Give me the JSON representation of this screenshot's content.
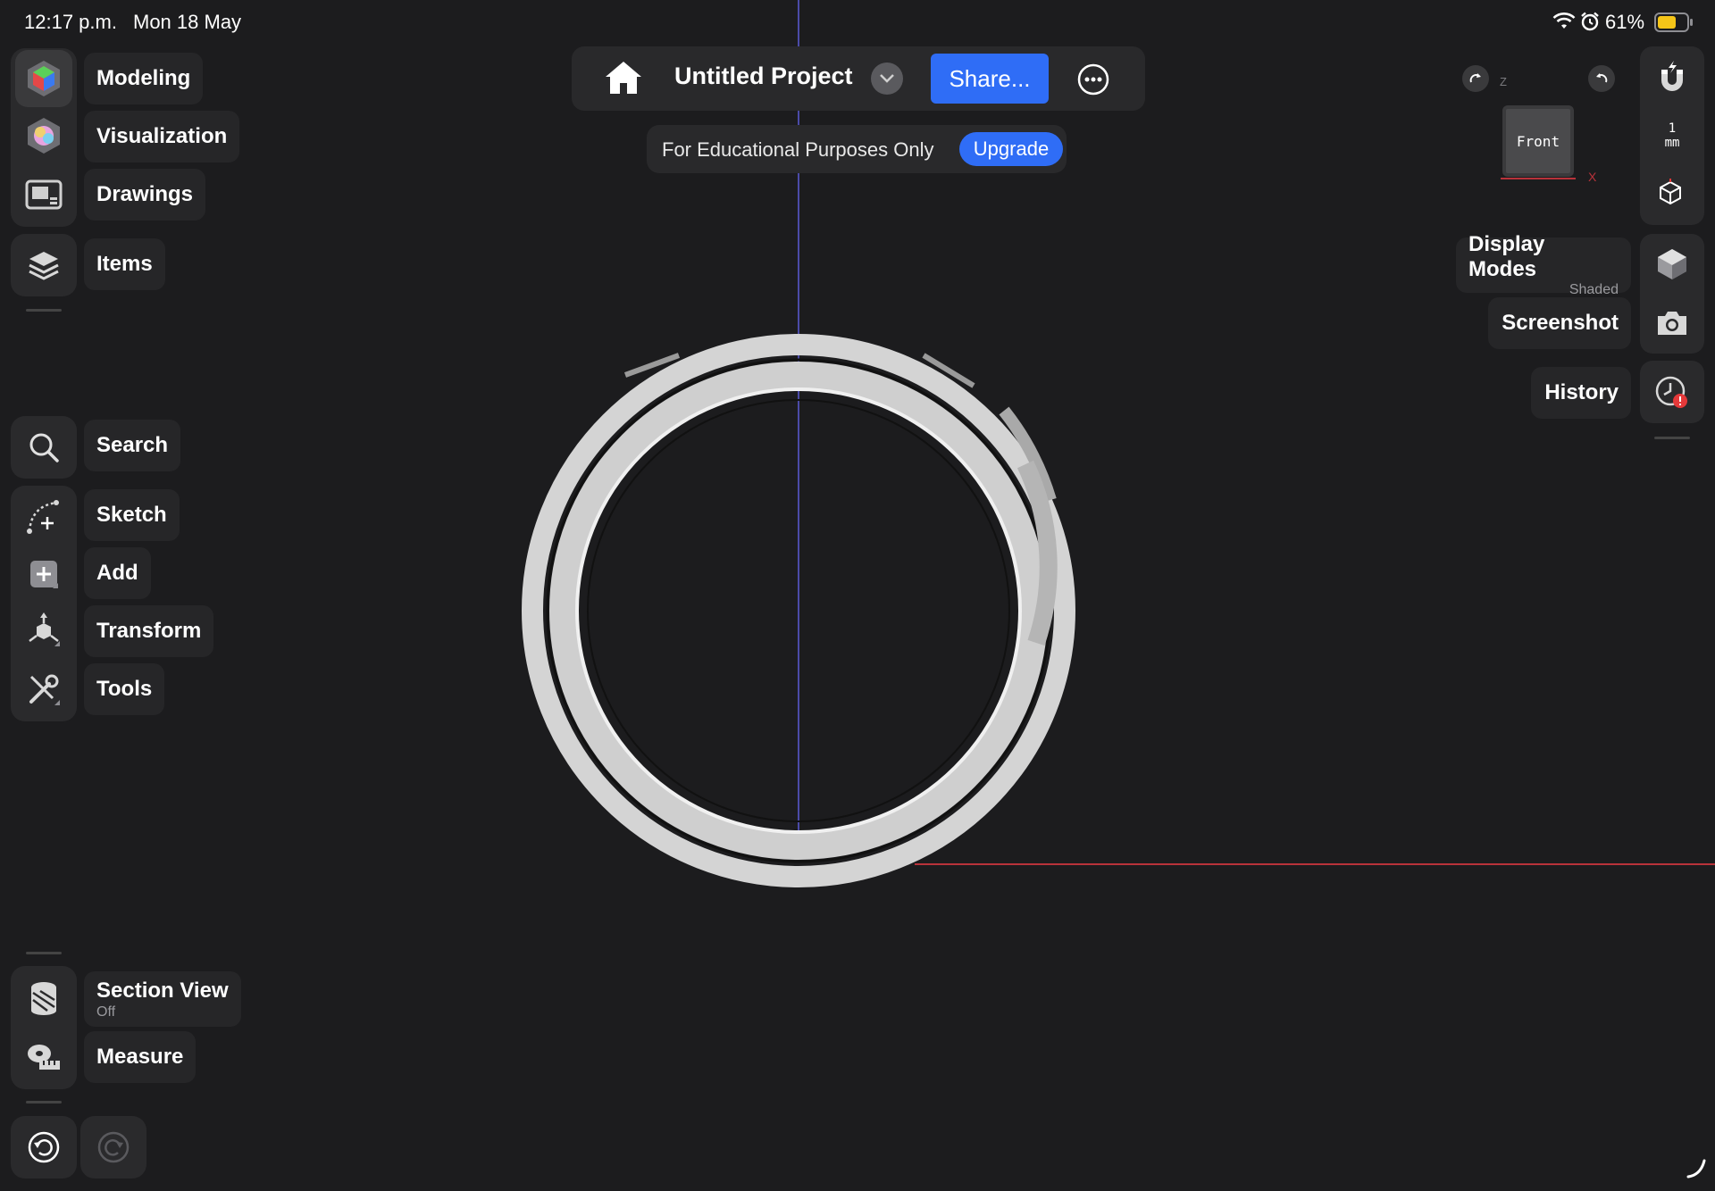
{
  "status_bar": {
    "time": "12:17 p.m.",
    "date": "Mon 18 May",
    "battery": "61%"
  },
  "left_toolbar": {
    "workspaces": [
      {
        "id": "modeling",
        "label": "Modeling",
        "icon": "modeling-icon"
      },
      {
        "id": "visualization",
        "label": "Visualization",
        "icon": "visualization-icon"
      },
      {
        "id": "drawings",
        "label": "Drawings",
        "icon": "drawings-icon"
      }
    ],
    "items_label": "Items",
    "tools": [
      {
        "id": "search",
        "label": "Search"
      },
      {
        "id": "sketch",
        "label": "Sketch"
      },
      {
        "id": "add",
        "label": "Add"
      },
      {
        "id": "transform",
        "label": "Transform"
      },
      {
        "id": "tools",
        "label": "Tools"
      }
    ],
    "section_view": {
      "label": "Section View",
      "state": "Off"
    },
    "measure_label": "Measure"
  },
  "top_bar": {
    "project_title": "Untitled Project",
    "share_label": "Share...",
    "edu_notice": "For Educational Purposes Only",
    "upgrade_label": "Upgrade"
  },
  "right_panel": {
    "view_cube_face": "Front",
    "axis_x": "X",
    "axis_z": "Z",
    "grid_unit_value": "1",
    "grid_unit": "mm",
    "display_modes": {
      "label": "Display Modes",
      "value": "Shaded"
    },
    "screenshot_label": "Screenshot",
    "history_label": "History"
  },
  "colors": {
    "background": "#1c1c1e",
    "accent": "#2f6df6",
    "y_axis": "#5b5bd6",
    "x_axis": "#b8323a",
    "model": "#d7d7d7",
    "alert": "#e5393a"
  }
}
